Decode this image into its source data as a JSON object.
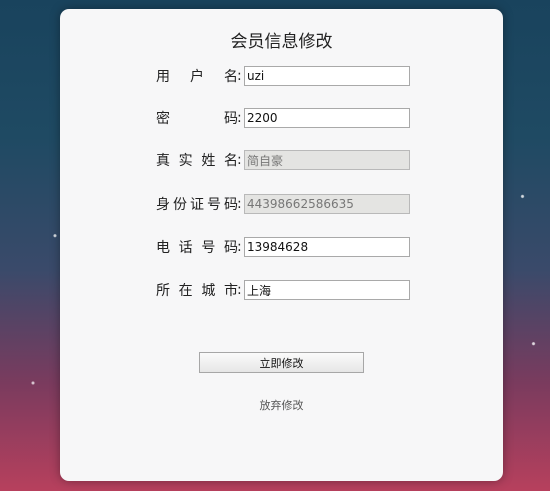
{
  "form": {
    "title": "会员信息修改",
    "fields": [
      {
        "label": "用户名",
        "value": "uzi"
      },
      {
        "label": "密码",
        "value": "2200"
      },
      {
        "label": "真实姓名",
        "value": "简自豪",
        "readonly": true
      },
      {
        "label": "身份证号码",
        "value": "44398662586635",
        "readonly": true
      },
      {
        "label": "电话号码",
        "value": "13984628"
      },
      {
        "label": "所在城市",
        "value": "上海"
      }
    ],
    "colon": ":",
    "submit_label": "立即修改",
    "cancel_label": "放弃修改"
  }
}
